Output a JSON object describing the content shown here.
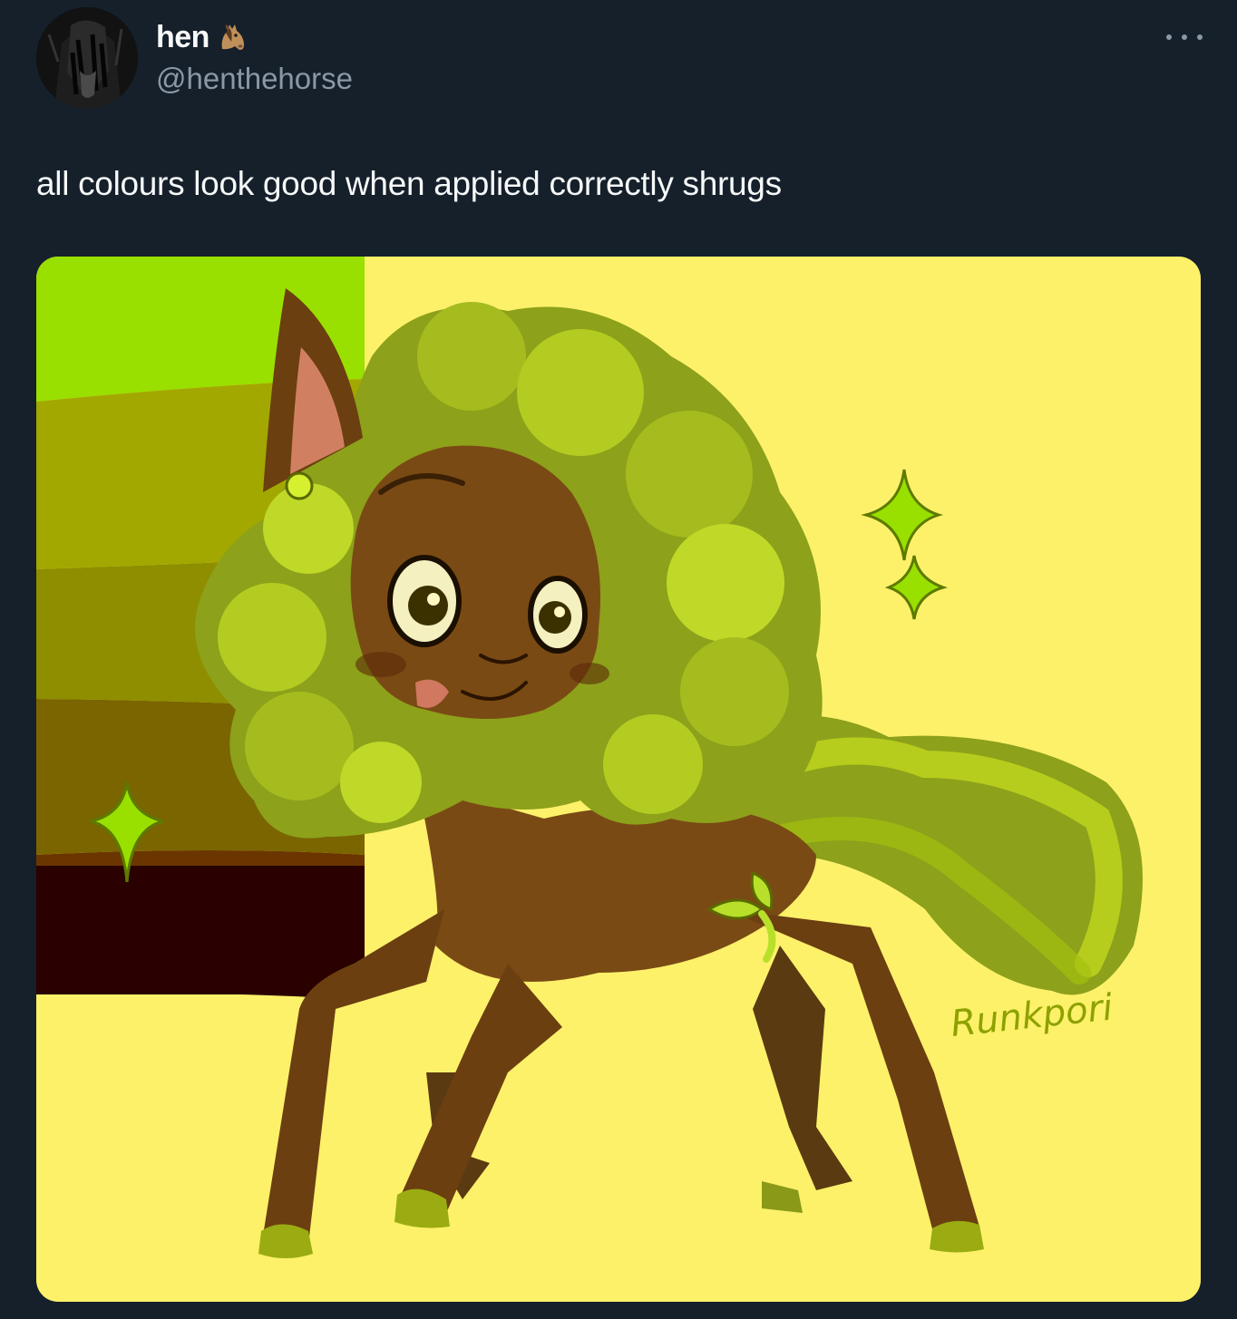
{
  "tweet": {
    "display_name": "hen",
    "name_emoji_icon": "horse-face-icon",
    "handle": "@henthehorse",
    "text": "all colours look good when applied correctly shrugs",
    "more_icon": "more-options-icon"
  },
  "media": {
    "artist_signature": "Runkpori",
    "palette_swatches": [
      "#99e000",
      "#a3a800",
      "#8e8e00",
      "#7a6500",
      "#6b3500",
      "#2a0000"
    ],
    "background_color": "#fdf16a"
  },
  "colors": {
    "page_background": "#15202b",
    "primary_text": "#f7f9f9",
    "secondary_text": "#8b98a5"
  }
}
